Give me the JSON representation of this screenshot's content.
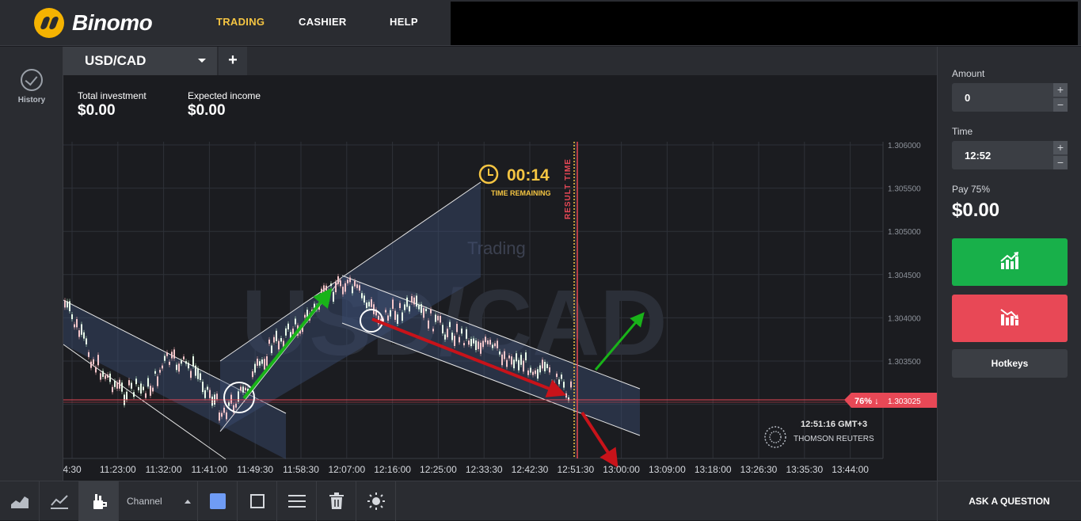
{
  "app": {
    "name": "Binomo"
  },
  "nav": {
    "trading": "TRADING",
    "cashier": "CASHIER",
    "help": "HELP"
  },
  "sidebar": {
    "history_label": "History"
  },
  "asset_tab": {
    "pair": "USD/CAD",
    "add": "+"
  },
  "info": {
    "total_investment_label": "Total investment",
    "total_investment_value": "$0.00",
    "expected_income_label": "Expected income",
    "expected_income_value": "$0.00"
  },
  "chart_data": {
    "type": "line",
    "title": "",
    "watermark": "USD/CAD",
    "watermark_small": "Trading",
    "y_ticks": [
      "1.306000",
      "1.305500",
      "1.305000",
      "1.304500",
      "1.304000",
      "1.303500",
      "1.303025",
      "1.302500"
    ],
    "x_ticks": [
      "4:30",
      "11:23:00",
      "11:32:00",
      "11:41:00",
      "11:49:30",
      "11:58:30",
      "12:07:00",
      "12:16:00",
      "12:25:00",
      "12:33:30",
      "12:42:30",
      "12:51:30",
      "13:00:00",
      "13:09:00",
      "13:18:00",
      "13:26:30",
      "13:35:30",
      "13:44:00"
    ],
    "current_price": "1.303025",
    "current_badge": "76% ↓",
    "timer": "00:14",
    "timer_label": "TIME REMAINING",
    "result_time_label": "RESULT TIME",
    "clock": "12:51:16 GMT+3",
    "provider": "THOMSON REUTERS",
    "ylim": [
      1.3023,
      1.3061
    ],
    "colors": {
      "up": "#18b04a",
      "down": "#e84856",
      "price_line": "#e84856",
      "accent": "#f5c542"
    }
  },
  "trade": {
    "amount_label": "Amount",
    "amount_value": "0",
    "time_label": "Time",
    "time_value": "12:52",
    "pay_label": "Pay 75%",
    "pay_value": "$0.00",
    "hotkeys": "Hotkeys",
    "up_icon": "chart-up-icon",
    "down_icon": "chart-down-icon"
  },
  "toolbar": {
    "channel": "Channel",
    "ask": "ASK A QUESTION"
  }
}
